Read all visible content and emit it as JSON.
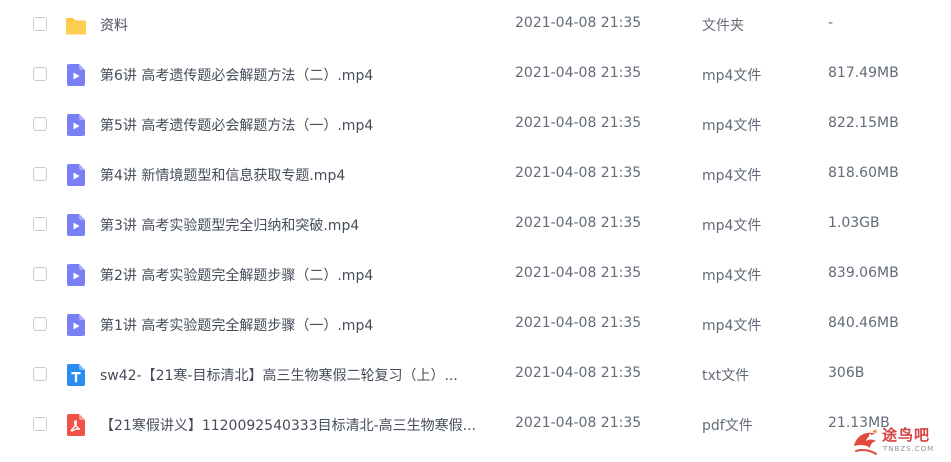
{
  "files": [
    {
      "name": "资料",
      "date": "2021-04-08 21:35",
      "type": "文件夹",
      "size": "-",
      "icon": "folder-icon"
    },
    {
      "name": "第6讲 高考遗传题必会解题方法（二）.mp4",
      "date": "2021-04-08 21:35",
      "type": "mp4文件",
      "size": "817.49MB",
      "icon": "video-file-icon"
    },
    {
      "name": "第5讲 高考遗传题必会解题方法（一）.mp4",
      "date": "2021-04-08 21:35",
      "type": "mp4文件",
      "size": "822.15MB",
      "icon": "video-file-icon"
    },
    {
      "name": "第4讲 新情境题型和信息获取专题.mp4",
      "date": "2021-04-08 21:35",
      "type": "mp4文件",
      "size": "818.60MB",
      "icon": "video-file-icon"
    },
    {
      "name": "第3讲 高考实验题型完全归纳和突破.mp4",
      "date": "2021-04-08 21:35",
      "type": "mp4文件",
      "size": "1.03GB",
      "icon": "video-file-icon"
    },
    {
      "name": "第2讲 高考实验题完全解题步骤（二）.mp4",
      "date": "2021-04-08 21:35",
      "type": "mp4文件",
      "size": "839.06MB",
      "icon": "video-file-icon"
    },
    {
      "name": "第1讲 高考实验题完全解题步骤（一）.mp4",
      "date": "2021-04-08 21:35",
      "type": "mp4文件",
      "size": "840.46MB",
      "icon": "video-file-icon"
    },
    {
      "name": "sw42-【21寒-目标清北】高三生物寒假二轮复习（上）...",
      "date": "2021-04-08 21:35",
      "type": "txt文件",
      "size": "306B",
      "icon": "text-file-icon"
    },
    {
      "name": "【21寒假讲义】1120092540333目标清北-高三生物寒假...",
      "date": "2021-04-08 21:35",
      "type": "pdf文件",
      "size": "21.13MB",
      "icon": "pdf-file-icon"
    }
  ],
  "watermark": {
    "text": "途鸟吧",
    "sub": "TNBZS.COM"
  },
  "colors": {
    "folder": "#ffc53d",
    "video": "#7b7ff5",
    "text": "#2b8cf0",
    "pdf": "#f0524a"
  }
}
